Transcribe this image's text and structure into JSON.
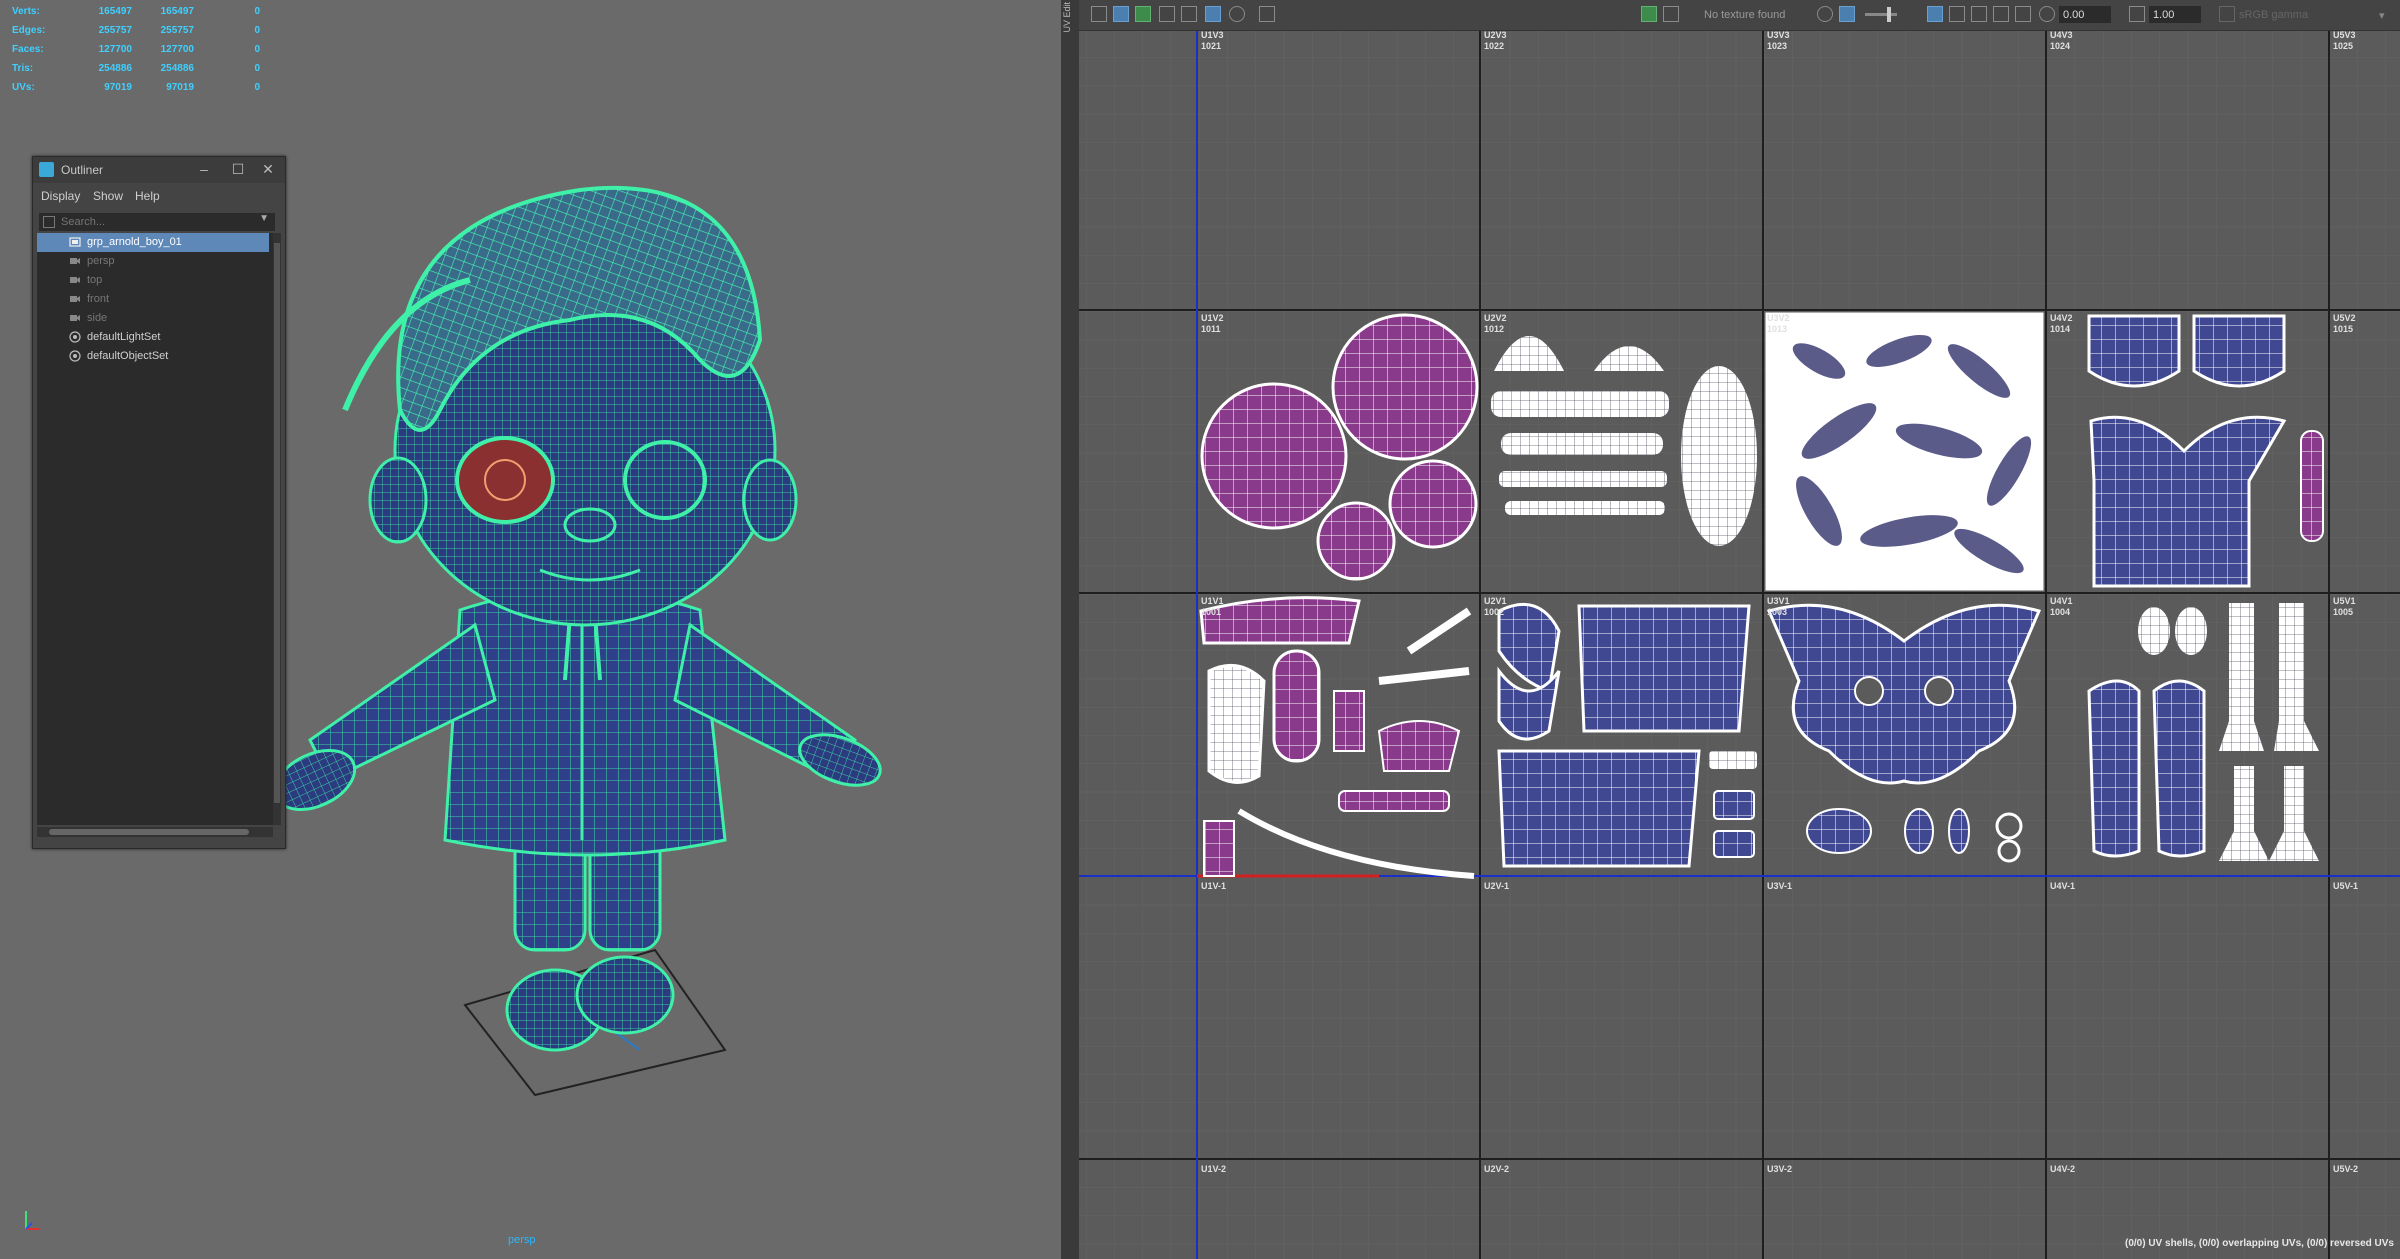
{
  "hud": {
    "rows": [
      {
        "label": "Verts:",
        "a": "165497",
        "b": "165497",
        "c": "0"
      },
      {
        "label": "Edges:",
        "a": "255757",
        "b": "255757",
        "c": "0"
      },
      {
        "label": "Faces:",
        "a": "127700",
        "b": "127700",
        "c": "0"
      },
      {
        "label": "Tris:",
        "a": "254886",
        "b": "254886",
        "c": "0"
      },
      {
        "label": "UVs:",
        "a": "97019",
        "b": "97019",
        "c": "0"
      }
    ]
  },
  "viewport": {
    "camera_label": "persp"
  },
  "outliner": {
    "title": "Outliner",
    "menu": [
      "Display",
      "Show",
      "Help"
    ],
    "search_placeholder": "Search...",
    "items": [
      {
        "label": "grp_arnold_boy_01",
        "icon": "group-icon",
        "selected": true
      },
      {
        "label": "persp",
        "icon": "camera-icon",
        "dim": true
      },
      {
        "label": "top",
        "icon": "camera-icon",
        "dim": true
      },
      {
        "label": "front",
        "icon": "camera-icon",
        "dim": true
      },
      {
        "label": "side",
        "icon": "camera-icon",
        "dim": true
      },
      {
        "label": "defaultLightSet",
        "icon": "set-icon"
      },
      {
        "label": "defaultObjectSet",
        "icon": "set-icon"
      }
    ]
  },
  "uv_editor": {
    "panel_tag": "UV Edit",
    "toolbar": {
      "texture_status": "No texture found",
      "exposure": "0.00",
      "gamma": "1.00",
      "colorspace": "sRGB gamma"
    },
    "udim_rows": [
      [
        "U1V3\n1021",
        "U2V3\n1022",
        "U3V3\n1023",
        "U4V3\n1024",
        "U5V3\n1025"
      ],
      [
        "U1V2\n1011",
        "U2V2\n1012",
        "U3V2\n1013",
        "U4V2\n1014",
        "U5V2\n1015"
      ],
      [
        "U1V1\n1001",
        "U2V1\n1002",
        "U3V1\n1003",
        "U4V1\n1004",
        "U5V1\n1005"
      ],
      [
        "U1V-1",
        "U2V-1",
        "U3V-1",
        "U4V-1",
        "U5V-1"
      ],
      [
        "U1V-2",
        "U2V-2",
        "U3V-2",
        "U4V-2",
        "U5V-2"
      ]
    ],
    "status": "(0/0) UV shells, (0/0) overlapping UVs, (0/0) reversed UVs"
  },
  "colors": {
    "wire_green": "#3ff0a8",
    "mesh_blue": "#2f3f8a",
    "uv_purple": "#8a3a8a",
    "uv_blue": "#3f4890",
    "axis_red": "#d02020",
    "axis_blue": "#1a2fc8",
    "selection": "#5d88b8"
  }
}
